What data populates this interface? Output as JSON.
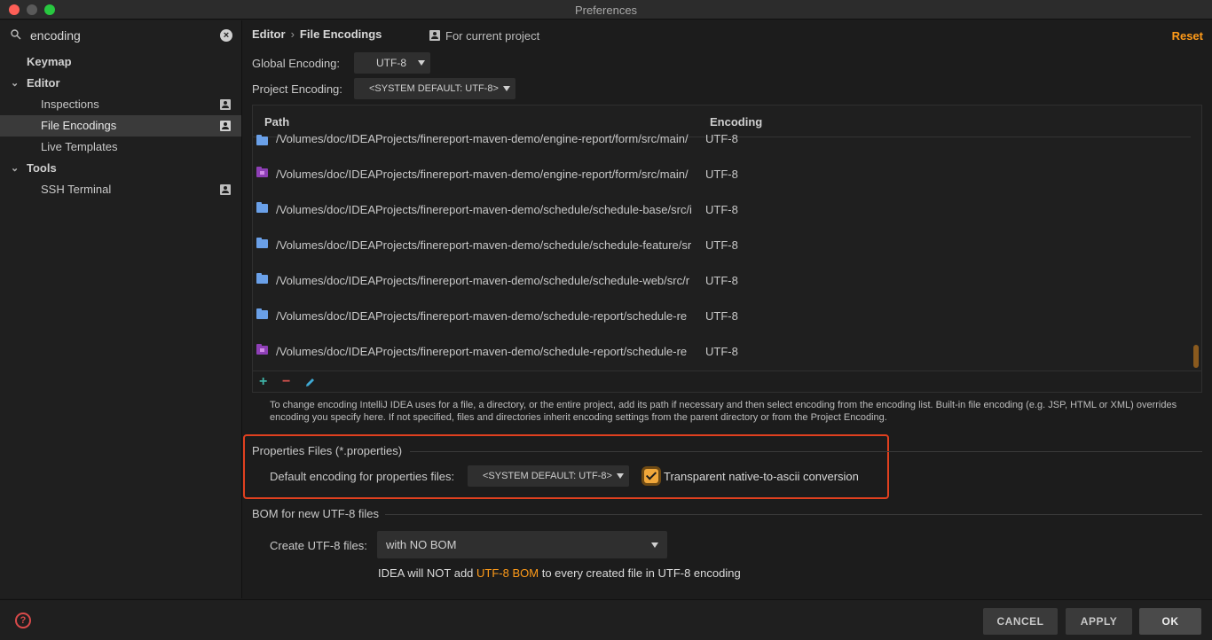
{
  "window": {
    "title": "Preferences"
  },
  "colors": {
    "accent": "#ff9b19",
    "highlight_border": "#e0401f",
    "folder_blue": "#6aa0e8",
    "folder_module": "#8e3fb6"
  },
  "sidebar": {
    "search_value": "encoding",
    "search_icon": "search-icon",
    "items": [
      {
        "label": "Keymap"
      },
      {
        "label": "Editor"
      },
      {
        "label": "Inspections"
      },
      {
        "label": "File Encodings"
      },
      {
        "label": "Live Templates"
      },
      {
        "label": "Tools"
      },
      {
        "label": "SSH Terminal"
      }
    ]
  },
  "header": {
    "breadcrumb": [
      "Editor",
      "File Encodings"
    ],
    "for_current_project": "For current project",
    "reset": "Reset"
  },
  "encodings": {
    "global_label": "Global Encoding:",
    "global_value": "UTF-8",
    "project_label": "Project Encoding:",
    "project_value": "<SYSTEM DEFAULT: UTF-8>"
  },
  "table": {
    "columns": [
      "Path",
      "Encoding"
    ],
    "rows": [
      {
        "path": "/Volumes/doc/IDEAProjects/finereport-maven-demo/engine-report/form/src/main/",
        "encoding": "UTF-8",
        "icon": "folder"
      },
      {
        "path": "/Volumes/doc/IDEAProjects/finereport-maven-demo/engine-report/form/src/main/",
        "encoding": "UTF-8",
        "icon": "module"
      },
      {
        "path": "/Volumes/doc/IDEAProjects/finereport-maven-demo/schedule/schedule-base/src/i",
        "encoding": "UTF-8",
        "icon": "folder"
      },
      {
        "path": "/Volumes/doc/IDEAProjects/finereport-maven-demo/schedule/schedule-feature/sr",
        "encoding": "UTF-8",
        "icon": "folder"
      },
      {
        "path": "/Volumes/doc/IDEAProjects/finereport-maven-demo/schedule/schedule-web/src/r",
        "encoding": "UTF-8",
        "icon": "folder"
      },
      {
        "path": "/Volumes/doc/IDEAProjects/finereport-maven-demo/schedule-report/schedule-re",
        "encoding": "UTF-8",
        "icon": "folder"
      },
      {
        "path": "/Volumes/doc/IDEAProjects/finereport-maven-demo/schedule-report/schedule-re",
        "encoding": "UTF-8",
        "icon": "module"
      }
    ],
    "add": "+",
    "remove": "−"
  },
  "help_text": "To change encoding IntelliJ IDEA uses for a file, a directory, or the entire project, add its path if necessary and then select encoding from the encoding list. Built-in file encoding (e.g. JSP, HTML or XML) overrides encoding you specify here. If not specified, files and directories inherit encoding settings from the parent directory or from the Project Encoding.",
  "properties": {
    "title": "Properties Files (*.properties)",
    "default_label": "Default encoding for properties files:",
    "default_value": "<SYSTEM DEFAULT: UTF-8>",
    "transparent_label": "Transparent native-to-ascii conversion",
    "transparent_checked": true
  },
  "bom": {
    "title": "BOM for new UTF-8 files",
    "create_label": "Create UTF-8 files:",
    "create_value": "with NO BOM",
    "note_prefix": "IDEA will NOT add ",
    "note_accent": "UTF-8 BOM",
    "note_suffix": " to every created file in UTF-8 encoding"
  },
  "footer": {
    "help": "?",
    "cancel": "CANCEL",
    "apply": "APPLY",
    "ok": "OK"
  }
}
